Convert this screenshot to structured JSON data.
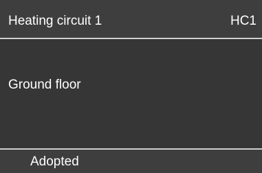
{
  "header": {
    "title": "Heating circuit 1",
    "code": "HC1"
  },
  "main": {
    "value": "Ground floor"
  },
  "footer": {
    "status": "Adopted"
  },
  "colors": {
    "background": "#3a3a3a",
    "text": "#ffffff",
    "divider": "#cfcfcf"
  }
}
